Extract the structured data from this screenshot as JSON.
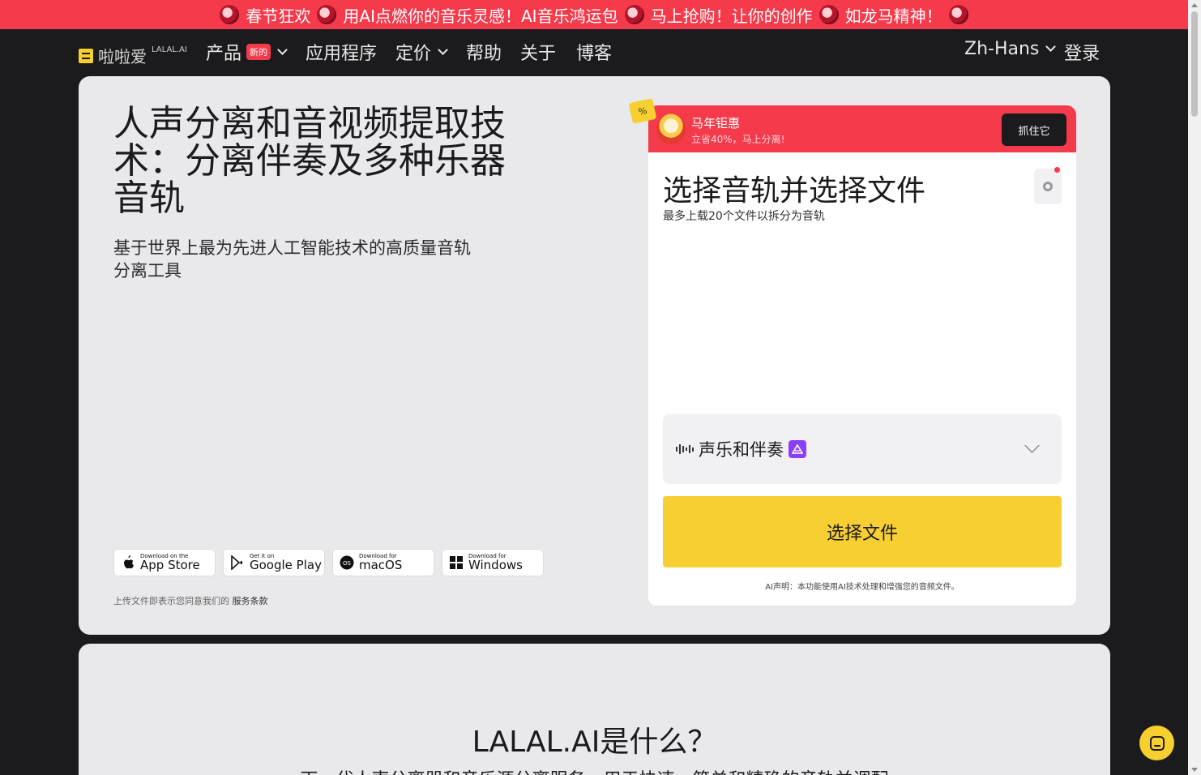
{
  "promo": {
    "segments": [
      "春节狂欢",
      "用AI点燃你的音乐灵感！AI音乐鸿运包",
      "马上抢购！让你的创作",
      "如龙马精神！"
    ]
  },
  "nav": {
    "logo_text": "啦啦爱",
    "logo_sup": "LALAL.AI",
    "items": [
      {
        "label": "产品",
        "badge": "新的"
      },
      {
        "label": "应用程序"
      },
      {
        "label": "定价"
      },
      {
        "label": "帮助"
      },
      {
        "label": "关于"
      },
      {
        "label": "博客"
      }
    ],
    "language": "Zh-Hans",
    "login": "登录"
  },
  "hero": {
    "title": "人声分离和音视频提取技术：分离伴奏及多种乐器音轨",
    "subtitle": "基于世界上最为先进人工智能技术的高质量音轨分离工具",
    "stores": [
      {
        "small": "Download on the",
        "big": "App Store",
        "icon": "apple-icon"
      },
      {
        "small": "Get it on",
        "big": "Google Play",
        "icon": "google-play-icon"
      },
      {
        "small": "Download for",
        "big": "macOS",
        "icon": "macos-icon"
      },
      {
        "small": "Download for",
        "big": "Windows",
        "icon": "windows-icon"
      }
    ],
    "terms_prefix": "上传文件即表示您同意我们的",
    "terms_link": "服务条款"
  },
  "offer": {
    "pct": "%",
    "title": "马年钜惠",
    "subtitle": "立省40%，马上分离!",
    "button": "抓住它"
  },
  "upload": {
    "title": "选择音轨并选择文件",
    "subtitle": "最多上载20个文件以拆分为音轨",
    "stem_select": "声乐和伴奏",
    "choose_button": "选择文件",
    "disclaimer": "AI声明：本功能使用AI技术处理和增强您的音频文件。"
  },
  "section2": {
    "title": "LALAL.AI是什么？",
    "subtitle": "下一代人声分离器和音乐源分离服务，用于快速、简单和精确的音轨并调配"
  },
  "colors": {
    "accent_red": "#f53a4b",
    "accent_yellow": "#f7cf32",
    "dark_bg": "#1b1a1c",
    "card_bg": "#e9e8ea",
    "pro_purple": "#8b3ff7"
  }
}
